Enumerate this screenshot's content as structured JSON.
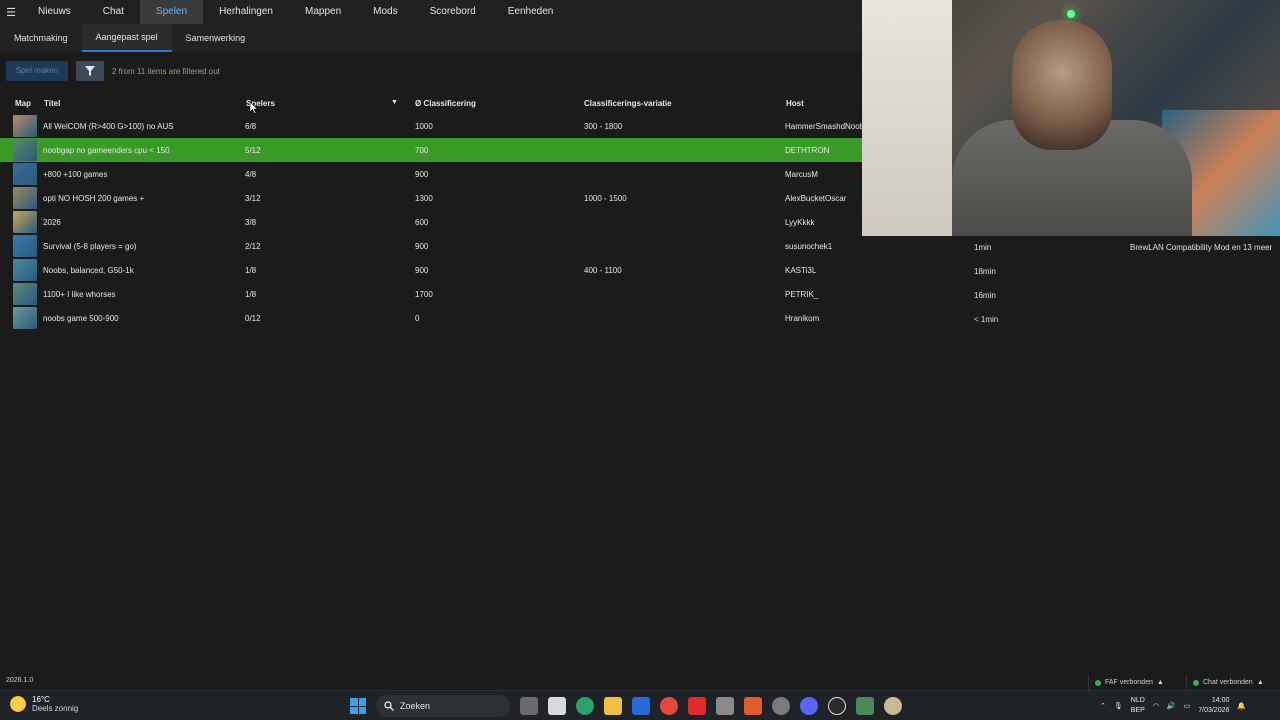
{
  "topnav": {
    "tabs": [
      {
        "label": "Nieuws"
      },
      {
        "label": "Chat"
      },
      {
        "label": "Spelen"
      },
      {
        "label": "Herhalingen"
      },
      {
        "label": "Mappen"
      },
      {
        "label": "Mods"
      },
      {
        "label": "Scorebord"
      },
      {
        "label": "Eenheden"
      }
    ],
    "active_index": 2
  },
  "subnav": {
    "tabs": [
      {
        "label": "Matchmaking"
      },
      {
        "label": "Aangepast spel"
      },
      {
        "label": "Samenwerking"
      }
    ],
    "active_index": 1
  },
  "toolbar": {
    "create_label": "Spel maken",
    "filter_note": "2 from 11 items are filtered out"
  },
  "table": {
    "headers": {
      "map": "Map",
      "title": "Titel",
      "players": "Spelers",
      "rating": "Ø Classificering",
      "variation": "Classificerings-variatie",
      "host": "Host"
    },
    "rows": [
      {
        "title": "All WelCOM (R>400 G>100) no AUS",
        "players": "6/8",
        "rating": "1000",
        "variation": "300 - 1800",
        "host": "HammerSmashdNoob",
        "thumb_color": "#b98a6a"
      },
      {
        "title": "noobgap no gameenders cpu < 150",
        "players": "5/12",
        "rating": "700",
        "variation": "",
        "host": "DETHTRON",
        "thumb_color": "#5a8a6a"
      },
      {
        "title": "+800 +100 games",
        "players": "4/8",
        "rating": "900",
        "variation": "",
        "host": "MarcusM",
        "thumb_color": "#3a6a9a"
      },
      {
        "title": "opti NO HOSH 200 games +",
        "players": "3/12",
        "rating": "1300",
        "variation": "1000 - 1500",
        "host": "AlexBucketOscar",
        "thumb_color": "#9a8a5a"
      },
      {
        "title": "2026",
        "players": "3/8",
        "rating": "600",
        "variation": "",
        "host": "LyyKkkk",
        "thumb_color": "#c8a85a"
      },
      {
        "title": "Survival (5-8 players = go)",
        "players": "2/12",
        "rating": "900",
        "variation": "",
        "host": "susunochek1",
        "thumb_color": "#3a7ab0"
      },
      {
        "title": "Noobs, balanced, G50-1k",
        "players": "1/8",
        "rating": "900",
        "variation": "400 - 1100",
        "host": "KASTi3L",
        "thumb_color": "#4a8aa0"
      },
      {
        "title": "1100+ I like whorses",
        "players": "1/8",
        "rating": "1700",
        "variation": "",
        "host": "PETRIK_",
        "thumb_color": "#5a8a7a"
      },
      {
        "title": "noobs game 500-900",
        "players": "0/12",
        "rating": "0",
        "variation": "",
        "host": "Hranikom",
        "thumb_color": "#6a9a9a"
      }
    ],
    "selected_index": 1
  },
  "right_info": {
    "times": [
      "1min",
      "18min",
      "16min",
      "< 1min"
    ],
    "mod_note": "BrewLAN Compatibility Mod en 13 meer"
  },
  "statusbar": {
    "version": "2026.1.0",
    "faf": "FAF verbonden",
    "chat": "Chat verbonden"
  },
  "taskbar": {
    "temp": "16°C",
    "weather": "Deels zonnig",
    "search": "Zoeken",
    "lang1": "NLD",
    "lang2": "BEP",
    "time": "14:00",
    "date": "7/03/2026"
  }
}
